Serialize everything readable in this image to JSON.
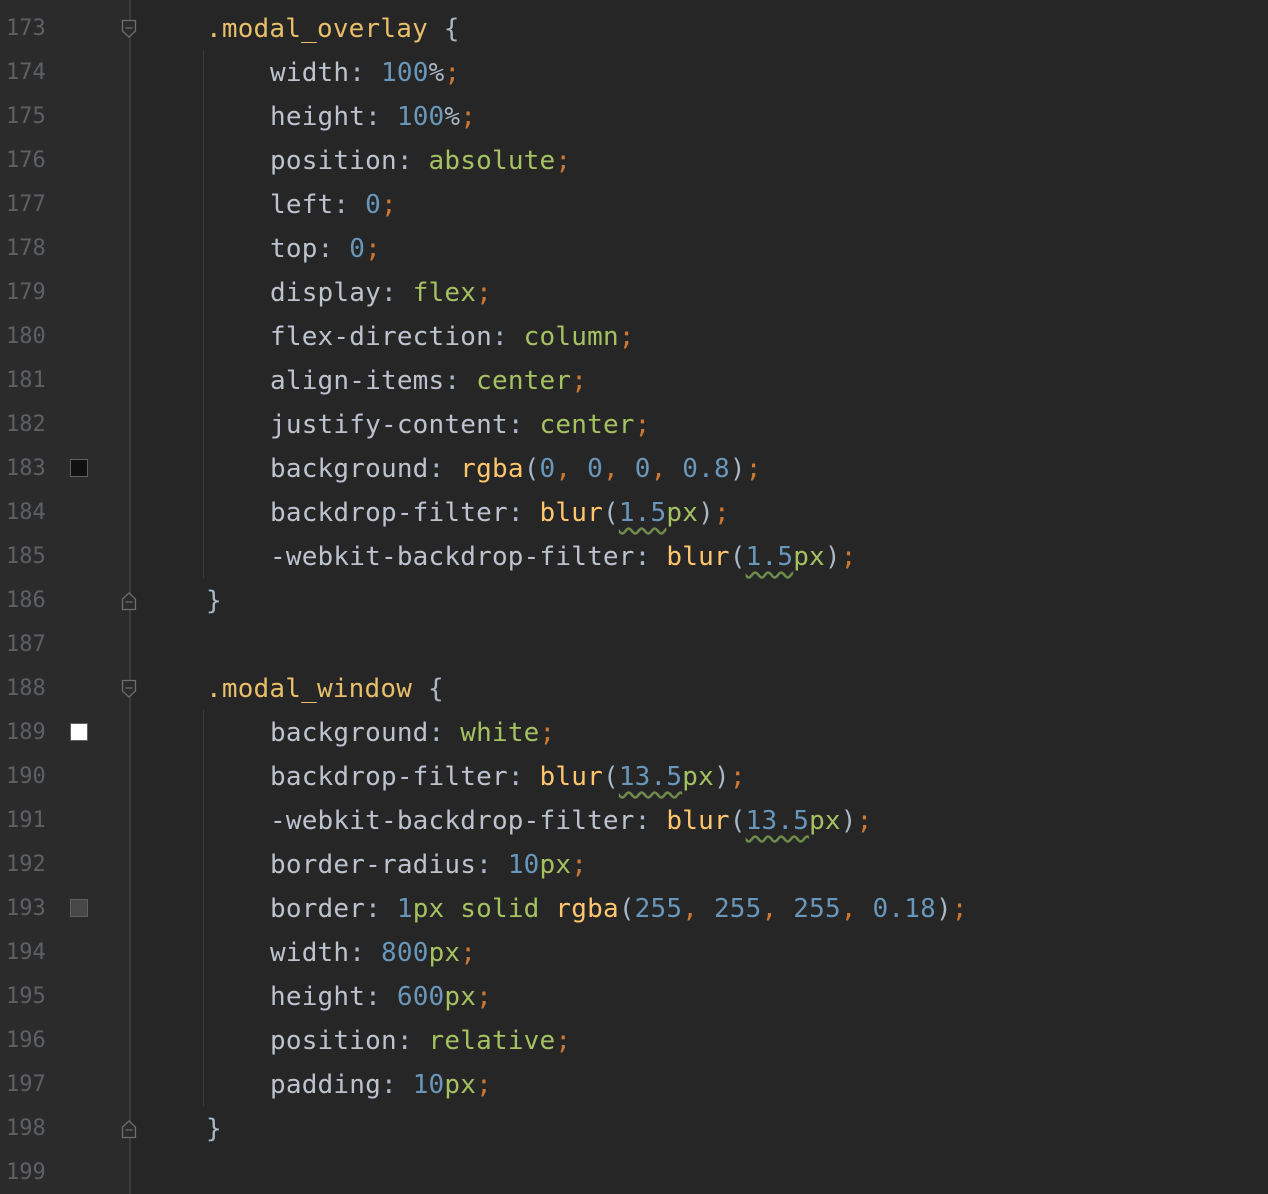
{
  "lines": [
    {
      "n": "173",
      "indent": 0,
      "fold": "open",
      "tokens": [
        [
          "sel",
          ".modal_overlay"
        ],
        [
          "punc",
          " {"
        ]
      ]
    },
    {
      "n": "174",
      "indent": 1,
      "tokens": [
        [
          "prop",
          "width"
        ],
        [
          "punc",
          ": "
        ],
        [
          "num",
          "100"
        ],
        [
          "punc",
          "%"
        ],
        [
          "semi",
          ";"
        ]
      ]
    },
    {
      "n": "175",
      "indent": 1,
      "tokens": [
        [
          "prop",
          "height"
        ],
        [
          "punc",
          ": "
        ],
        [
          "num",
          "100"
        ],
        [
          "punc",
          "%"
        ],
        [
          "semi",
          ";"
        ]
      ]
    },
    {
      "n": "176",
      "indent": 1,
      "tokens": [
        [
          "prop",
          "position"
        ],
        [
          "punc",
          ": "
        ],
        [
          "kw",
          "absolute"
        ],
        [
          "semi",
          ";"
        ]
      ]
    },
    {
      "n": "177",
      "indent": 1,
      "tokens": [
        [
          "prop",
          "left"
        ],
        [
          "punc",
          ": "
        ],
        [
          "num",
          "0"
        ],
        [
          "semi",
          ";"
        ]
      ]
    },
    {
      "n": "178",
      "indent": 1,
      "tokens": [
        [
          "prop",
          "top"
        ],
        [
          "punc",
          ": "
        ],
        [
          "num",
          "0"
        ],
        [
          "semi",
          ";"
        ]
      ]
    },
    {
      "n": "179",
      "indent": 1,
      "tokens": [
        [
          "prop",
          "display"
        ],
        [
          "punc",
          ": "
        ],
        [
          "kw",
          "flex"
        ],
        [
          "semi",
          ";"
        ]
      ]
    },
    {
      "n": "180",
      "indent": 1,
      "tokens": [
        [
          "prop",
          "flex-direction"
        ],
        [
          "punc",
          ": "
        ],
        [
          "kw",
          "column"
        ],
        [
          "semi",
          ";"
        ]
      ]
    },
    {
      "n": "181",
      "indent": 1,
      "tokens": [
        [
          "prop",
          "align-items"
        ],
        [
          "punc",
          ": "
        ],
        [
          "kw",
          "center"
        ],
        [
          "semi",
          ";"
        ]
      ]
    },
    {
      "n": "182",
      "indent": 1,
      "tokens": [
        [
          "prop",
          "justify-content"
        ],
        [
          "punc",
          ": "
        ],
        [
          "kw",
          "center"
        ],
        [
          "semi",
          ";"
        ]
      ]
    },
    {
      "n": "183",
      "indent": 1,
      "swatch": "#111111",
      "tokens": [
        [
          "prop",
          "background"
        ],
        [
          "punc",
          ": "
        ],
        [
          "fn",
          "rgba"
        ],
        [
          "punc",
          "("
        ],
        [
          "num",
          "0"
        ],
        [
          "semi",
          ", "
        ],
        [
          "num",
          "0"
        ],
        [
          "semi",
          ", "
        ],
        [
          "num",
          "0"
        ],
        [
          "semi",
          ", "
        ],
        [
          "num",
          "0.8"
        ],
        [
          "punc",
          ")"
        ],
        [
          "semi",
          ";"
        ]
      ]
    },
    {
      "n": "184",
      "indent": 1,
      "tokens": [
        [
          "prop",
          "backdrop-filter"
        ],
        [
          "punc",
          ": "
        ],
        [
          "fn",
          "blur"
        ],
        [
          "punc",
          "("
        ],
        [
          "num warn",
          "1.5"
        ],
        [
          "kw",
          "px"
        ],
        [
          "punc",
          ")"
        ],
        [
          "semi",
          ";"
        ]
      ]
    },
    {
      "n": "185",
      "indent": 1,
      "tokens": [
        [
          "prop",
          "-webkit-backdrop-filter"
        ],
        [
          "punc",
          ": "
        ],
        [
          "fn",
          "blur"
        ],
        [
          "punc",
          "("
        ],
        [
          "num warn",
          "1.5"
        ],
        [
          "kw",
          "px"
        ],
        [
          "punc",
          ")"
        ],
        [
          "semi",
          ";"
        ]
      ]
    },
    {
      "n": "186",
      "indent": 0,
      "fold": "close",
      "tokens": [
        [
          "punc",
          "}"
        ]
      ]
    },
    {
      "n": "187",
      "indent": 0,
      "tokens": []
    },
    {
      "n": "188",
      "indent": 0,
      "fold": "open",
      "tokens": [
        [
          "sel",
          ".modal_window"
        ],
        [
          "punc",
          " {"
        ]
      ]
    },
    {
      "n": "189",
      "indent": 1,
      "swatch": "#ffffff",
      "tokens": [
        [
          "prop",
          "background"
        ],
        [
          "punc",
          ": "
        ],
        [
          "kw",
          "white"
        ],
        [
          "semi",
          ";"
        ]
      ]
    },
    {
      "n": "190",
      "indent": 1,
      "tokens": [
        [
          "prop",
          "backdrop-filter"
        ],
        [
          "punc",
          ": "
        ],
        [
          "fn",
          "blur"
        ],
        [
          "punc",
          "("
        ],
        [
          "num warn",
          "13.5"
        ],
        [
          "kw",
          "px"
        ],
        [
          "punc",
          ")"
        ],
        [
          "semi",
          ";"
        ]
      ]
    },
    {
      "n": "191",
      "indent": 1,
      "tokens": [
        [
          "prop",
          "-webkit-backdrop-filter"
        ],
        [
          "punc",
          ": "
        ],
        [
          "fn",
          "blur"
        ],
        [
          "punc",
          "("
        ],
        [
          "num warn",
          "13.5"
        ],
        [
          "kw",
          "px"
        ],
        [
          "punc",
          ")"
        ],
        [
          "semi",
          ";"
        ]
      ]
    },
    {
      "n": "192",
      "indent": 1,
      "tokens": [
        [
          "prop",
          "border-radius"
        ],
        [
          "punc",
          ": "
        ],
        [
          "num",
          "10"
        ],
        [
          "kw",
          "px"
        ],
        [
          "semi",
          ";"
        ]
      ]
    },
    {
      "n": "193",
      "indent": 1,
      "swatch": "#474747",
      "tokens": [
        [
          "prop",
          "border"
        ],
        [
          "punc",
          ": "
        ],
        [
          "num",
          "1"
        ],
        [
          "kw",
          "px solid "
        ],
        [
          "fn",
          "rgba"
        ],
        [
          "punc",
          "("
        ],
        [
          "num",
          "255"
        ],
        [
          "semi",
          ", "
        ],
        [
          "num",
          "255"
        ],
        [
          "semi",
          ", "
        ],
        [
          "num",
          "255"
        ],
        [
          "semi",
          ", "
        ],
        [
          "num",
          "0.18"
        ],
        [
          "punc",
          ")"
        ],
        [
          "semi",
          ";"
        ]
      ]
    },
    {
      "n": "194",
      "indent": 1,
      "tokens": [
        [
          "prop",
          "width"
        ],
        [
          "punc",
          ": "
        ],
        [
          "num",
          "800"
        ],
        [
          "kw",
          "px"
        ],
        [
          "semi",
          ";"
        ]
      ]
    },
    {
      "n": "195",
      "indent": 1,
      "tokens": [
        [
          "prop",
          "height"
        ],
        [
          "punc",
          ": "
        ],
        [
          "num",
          "600"
        ],
        [
          "kw",
          "px"
        ],
        [
          "semi",
          ";"
        ]
      ]
    },
    {
      "n": "196",
      "indent": 1,
      "tokens": [
        [
          "prop",
          "position"
        ],
        [
          "punc",
          ": "
        ],
        [
          "kw",
          "relative"
        ],
        [
          "semi",
          ";"
        ]
      ]
    },
    {
      "n": "197",
      "indent": 1,
      "tokens": [
        [
          "prop",
          "padding"
        ],
        [
          "punc",
          ": "
        ],
        [
          "num",
          "10"
        ],
        [
          "kw",
          "px"
        ],
        [
          "semi",
          ";"
        ]
      ]
    },
    {
      "n": "198",
      "indent": 0,
      "fold": "close",
      "tokens": [
        [
          "punc",
          "}"
        ]
      ]
    },
    {
      "n": "199",
      "indent": 0,
      "tokens": []
    }
  ]
}
